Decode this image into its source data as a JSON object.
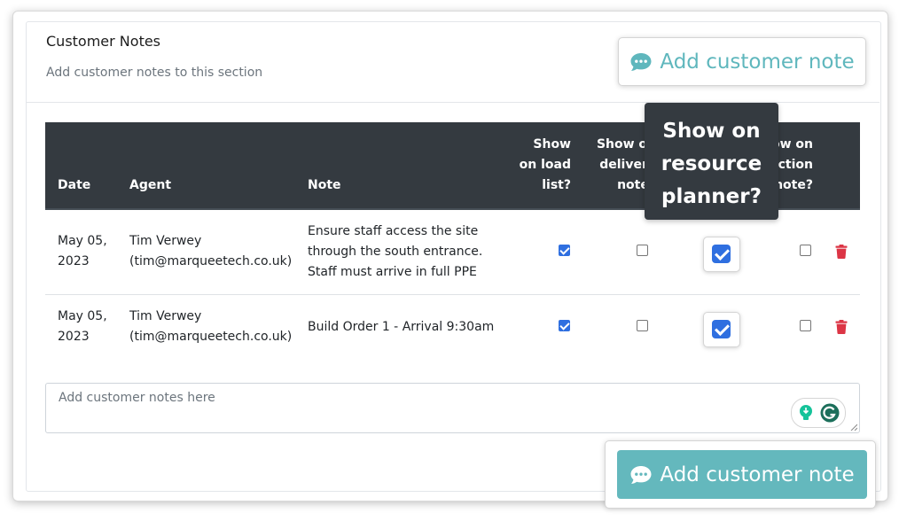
{
  "section": {
    "title": "Customer Notes",
    "subtitle": "Add customer notes to this section"
  },
  "add_button": {
    "label": "Add customer note",
    "icon": "comment-dots-icon"
  },
  "table": {
    "headers": {
      "date": "Date",
      "agent": "Agent",
      "note": "Note",
      "load_list": [
        "Show",
        "on load",
        "list?"
      ],
      "delivery_note": [
        "Show on",
        "delivery",
        "note?"
      ],
      "collection_note": [
        "Show on",
        "collection",
        "note?"
      ]
    },
    "rows": [
      {
        "date": [
          "May 05,",
          "2023"
        ],
        "agent": [
          "Tim Verwey",
          "(tim@marqueetech.co.uk)"
        ],
        "note": [
          "Ensure staff access the site",
          "through the south entrance.",
          "Staff must arrive in full PPE"
        ],
        "show_on_load_list": true,
        "show_on_delivery_note": false,
        "show_on_resource_planner": true,
        "show_on_collection_note": false
      },
      {
        "date": [
          "May 05,",
          "2023"
        ],
        "agent": [
          "Tim Verwey",
          "(tim@marqueetech.co.uk)"
        ],
        "note": [
          "Build Order 1 - Arrival 9:30am"
        ],
        "show_on_load_list": true,
        "show_on_delivery_note": false,
        "show_on_resource_planner": true,
        "show_on_collection_note": false
      }
    ]
  },
  "tooltip": {
    "lines": [
      "Show on",
      "resource",
      "planner?"
    ]
  },
  "note_input": {
    "placeholder": "Add customer notes here"
  },
  "colors": {
    "header_bg": "#343a40",
    "accent_teal": "#64b8bd",
    "checkbox_blue": "#2f6fe0",
    "delete_red": "#dc3545",
    "grammarly_green": "#15c39a"
  }
}
